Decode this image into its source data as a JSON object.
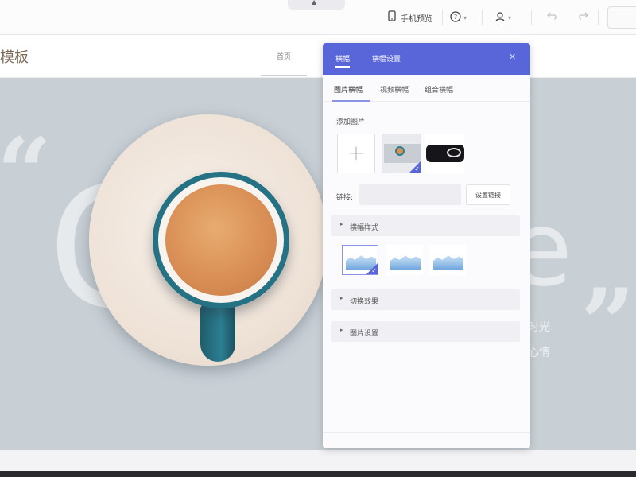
{
  "toolbar": {
    "mobile_view_label": "手机预览",
    "icons": {
      "mobile": "phone-icon",
      "help": "help-icon",
      "user": "user-icon",
      "undo": "undo-icon",
      "redo": "redo-icon"
    }
  },
  "site": {
    "title": "模板",
    "nav_item": "首页"
  },
  "banner": {
    "big_letter_left": "C",
    "big_letter_right": "e",
    "text_line1": "时光",
    "text_line2": "心情"
  },
  "panel": {
    "tabs": [
      "横幅",
      "横幅设置"
    ],
    "active_tab": 0,
    "sub_tabs": [
      "图片横幅",
      "视频横幅",
      "组合横幅"
    ],
    "active_sub_tab": 0,
    "add_image_label": "添加图片:",
    "link_label": "链接:",
    "link_value": "",
    "link_button": "设置链接",
    "sections": [
      {
        "title": "横幅样式",
        "expanded": true
      },
      {
        "title": "切换效果",
        "expanded": false
      },
      {
        "title": "图片设置",
        "expanded": false
      }
    ],
    "style_options_selected": 0,
    "accent_color": "#5966d9"
  }
}
